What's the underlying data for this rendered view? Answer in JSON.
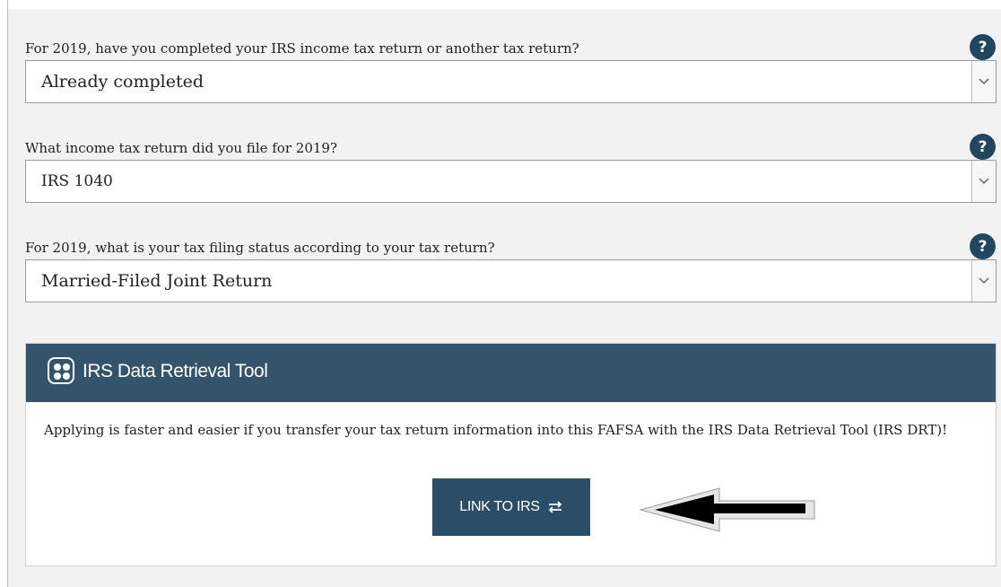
{
  "questions": [
    {
      "label": "For 2019, have you completed your IRS income tax return or another tax return?",
      "selected": "Already completed",
      "help": "?"
    },
    {
      "label": "What income tax return did you file for 2019?",
      "selected": "IRS 1040",
      "help": "?"
    },
    {
      "label": "For 2019, what is your tax filing status according to your tax return?",
      "selected": "Married-Filed Joint Return",
      "help": "?"
    }
  ],
  "drt": {
    "title": "IRS Data Retrieval Tool",
    "text": "Applying is faster and easier if you transfer your tax return information into this FAFSA with the IRS Data Retrieval Tool (IRS DRT)!",
    "button_label": "LINK TO IRS"
  },
  "colors": {
    "header_bg": "#34546c",
    "button_bg": "#2b4d68",
    "help_bg": "#20475f"
  }
}
